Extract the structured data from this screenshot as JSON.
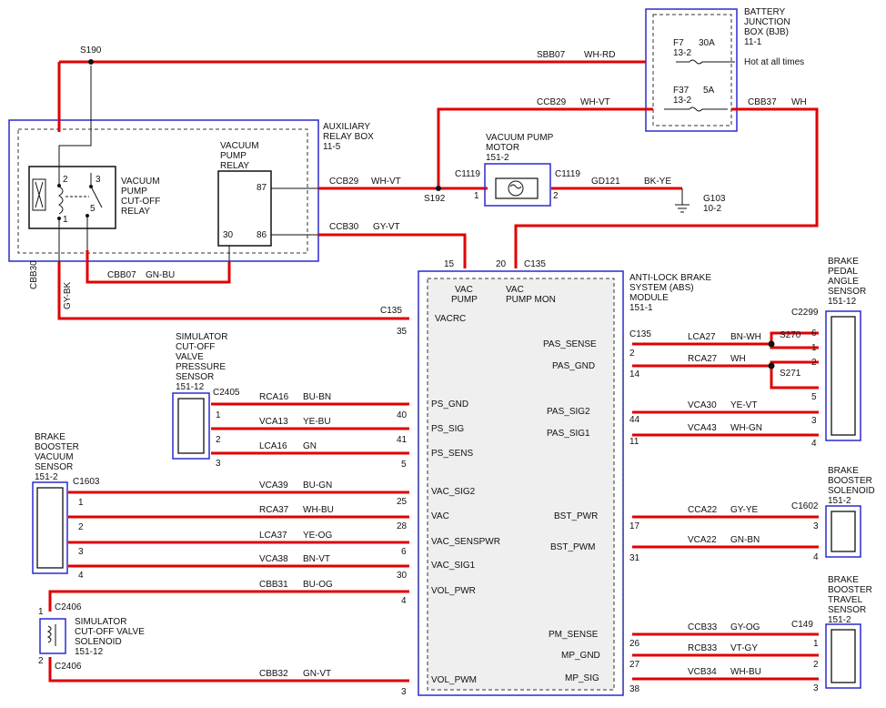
{
  "bjb": {
    "title_lines": [
      "BATTERY",
      "JUNCTION",
      "BOX (BJB)",
      "11-1"
    ],
    "f7": {
      "name": "F7",
      "amp": "30A",
      "loc": "13-2",
      "note": "Hot at all times"
    },
    "f37": {
      "name": "F37",
      "amp": "5A",
      "loc": "13-2"
    }
  },
  "arb": {
    "title_lines": [
      "AUXILIARY",
      "RELAY BOX",
      "11-5"
    ],
    "cutoff_relay_lines": [
      "VACUUM",
      "PUMP",
      "CUT-OFF",
      "RELAY"
    ],
    "pump_relay_lines": [
      "VACUUM",
      "PUMP",
      "RELAY"
    ],
    "pins": {
      "p2": "2",
      "p3": "3",
      "p1": "1",
      "p5": "5",
      "p87": "87",
      "p30": "30",
      "p86": "86"
    }
  },
  "motor": {
    "title_lines": [
      "VACUUM PUMP",
      "MOTOR",
      "151-2"
    ],
    "conn_left": "C1119",
    "conn_right": "C1119",
    "pin_left": "1",
    "pin_right": "2"
  },
  "ground": {
    "name": "G103",
    "loc": "10-2"
  },
  "splices": {
    "s190": "S190",
    "s192": "S192",
    "s270": "S270",
    "s271": "S271"
  },
  "wires": {
    "sbb07": "SBB07",
    "sbb07_c": "WH-RD",
    "ccb29a": "CCB29",
    "ccb29a_c": "WH-VT",
    "ccb29b": "CCB29",
    "ccb29b_c": "WH-VT",
    "cbb37": "CBB37",
    "cbb37_c": "WH",
    "gd121": "GD121",
    "gd121_c": "BK-YE",
    "ccb30": "CCB30",
    "ccb30_c": "GY-VT",
    "cbb07": "CBB07",
    "cbb07_c": "GN-BU",
    "cbb30": "CBB30",
    "cbb30_c": "GY-BK"
  },
  "abs": {
    "title_lines": [
      "ANTI-LOCK BRAKE",
      "SYSTEM (ABS)",
      "MODULE",
      "151-1"
    ],
    "conn_left": "C135",
    "conn_top": "C135",
    "conn_right": "C135",
    "top_pin1": "15",
    "top_pin2": "20",
    "top_lbl1a": "VAC",
    "top_lbl1b": "PUMP",
    "top_lbl2a": "VAC",
    "top_lbl2b": "PUMP MON",
    "left_pins": [
      {
        "sig": "VACRC",
        "pin": "35"
      },
      {
        "sig": "PS_GND",
        "pin": "40"
      },
      {
        "sig": "PS_SIG",
        "pin": "41"
      },
      {
        "sig": "PS_SENS",
        "pin": "5"
      },
      {
        "sig": "VAC_SIG2",
        "pin": "25"
      },
      {
        "sig": "VAC",
        "pin": "28"
      },
      {
        "sig": "VAC_SENSPWR",
        "pin": "6"
      },
      {
        "sig": "VAC_SIG1",
        "pin": "30"
      },
      {
        "sig": "VOL_PWR",
        "pin": "4"
      },
      {
        "sig": "VOL_PWM",
        "pin": "3"
      }
    ],
    "right_pins": [
      {
        "sig": "PAS_SENSE",
        "pin": "2"
      },
      {
        "sig": "PAS_GND",
        "pin": "14"
      },
      {
        "sig": "PAS_SIG2",
        "pin": "44"
      },
      {
        "sig": "PAS_SIG1",
        "pin": "11"
      },
      {
        "sig": "BST_PWR",
        "pin": "17"
      },
      {
        "sig": "BST_PWM",
        "pin": "31"
      },
      {
        "sig": "PM_SENSE",
        "pin": "26"
      },
      {
        "sig": "MP_GND",
        "pin": "27"
      },
      {
        "sig": "MP_SIG",
        "pin": "38"
      }
    ]
  },
  "sim_sensor": {
    "title_lines": [
      "SIMULATOR",
      "CUT-OFF",
      "VALVE",
      "PRESSURE",
      "SENSOR",
      "151-12"
    ],
    "conn": "C2405",
    "pins": [
      "1",
      "2",
      "3"
    ],
    "wires": [
      {
        "id": "RCA16",
        "c": "BU-BN"
      },
      {
        "id": "VCA13",
        "c": "YE-BU"
      },
      {
        "id": "LCA16",
        "c": "GN"
      }
    ]
  },
  "bbvs": {
    "title_lines": [
      "BRAKE",
      "BOOSTER",
      "VACUUM",
      "SENSOR",
      "151-2"
    ],
    "conn": "C1603",
    "pins": [
      "1",
      "2",
      "3",
      "4"
    ],
    "wires": [
      {
        "id": "VCA39",
        "c": "BU-GN"
      },
      {
        "id": "RCA37",
        "c": "WH-BU"
      },
      {
        "id": "LCA37",
        "c": "YE-OG"
      },
      {
        "id": "VCA38",
        "c": "BN-VT"
      }
    ]
  },
  "solenoid": {
    "title_lines": [
      "SIMULATOR",
      "CUT-OFF VALVE",
      "SOLENOID",
      "151-12"
    ],
    "conn_top": "C2406",
    "conn_bot": "C2406",
    "pin_top": "1",
    "pin_bot": "2",
    "wires": [
      {
        "id": "CBB31",
        "c": "BU-OG"
      },
      {
        "id": "CBB32",
        "c": "GN-VT"
      }
    ]
  },
  "bpas": {
    "title_lines": [
      "BRAKE",
      "PEDAL",
      "ANGLE",
      "SENSOR",
      "151-12"
    ],
    "conn": "C2299",
    "pins": [
      "6",
      "1",
      "2",
      "5",
      "3",
      "4"
    ],
    "wires": [
      {
        "id": "LCA27",
        "c": "BN-WH"
      },
      {
        "id": "RCA27",
        "c": "WH"
      },
      {
        "id": "VCA30",
        "c": "YE-VT"
      },
      {
        "id": "VCA43",
        "c": "WH-GN"
      }
    ]
  },
  "bbsol": {
    "title_lines": [
      "BRAKE",
      "BOOSTER",
      "SOLENOID",
      "151-2"
    ],
    "conn": "C1602",
    "pins": [
      "3",
      "4"
    ],
    "wires": [
      {
        "id": "CCA22",
        "c": "GY-YE"
      },
      {
        "id": "VCA22",
        "c": "GN-BN"
      }
    ]
  },
  "bbts": {
    "title_lines": [
      "BRAKE",
      "BOOSTER",
      "TRAVEL",
      "SENSOR",
      "151-2"
    ],
    "conn": "C149",
    "pins": [
      "1",
      "2",
      "3"
    ],
    "wires": [
      {
        "id": "CCB33",
        "c": "GY-OG"
      },
      {
        "id": "RCB33",
        "c": "VT-GY"
      },
      {
        "id": "VCB34",
        "c": "WH-BU"
      }
    ]
  }
}
